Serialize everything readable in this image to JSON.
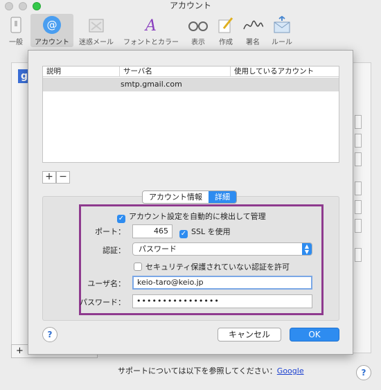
{
  "window": {
    "title": "アカウント"
  },
  "toolbar": {
    "items": [
      {
        "label": "一般",
        "icon": "general-icon"
      },
      {
        "label": "アカウント",
        "icon": "at-sign-icon"
      },
      {
        "label": "迷惑メール",
        "icon": "junk-icon"
      },
      {
        "label": "フォントとカラー",
        "icon": "font-color-icon"
      },
      {
        "label": "表示",
        "icon": "glasses-icon"
      },
      {
        "label": "作成",
        "icon": "compose-icon"
      },
      {
        "label": "署名",
        "icon": "signature-icon"
      },
      {
        "label": "ルール",
        "icon": "rules-icon"
      }
    ]
  },
  "table": {
    "headers": [
      "説明",
      "サーバ名",
      "使用しているアカウント"
    ],
    "rows": [
      {
        "description": "",
        "server": "smtp.gmail.com",
        "account": ""
      }
    ]
  },
  "buttons": {
    "add": "+",
    "remove": "−",
    "cancel": "キャンセル",
    "ok": "OK"
  },
  "tabs": {
    "info": "アカウント情報",
    "advanced": "詳細"
  },
  "form": {
    "auto_detect": "アカウント設定を自動的に検出して管理",
    "port_label": "ポート：",
    "port_value": "465",
    "ssl_label": "SSL を使用",
    "auth_label": "認証：",
    "auth_value": "パスワード",
    "insecure_label": "セキュリティ保護されていない認証を許可",
    "user_label": "ユーザ名：",
    "user_value": "keio-taro@keio.jp",
    "password_label": "パスワード：",
    "password_value": "••••••••••••••••"
  },
  "background": {
    "badge": "g",
    "support_text": "サポートについては以下を参照してください：",
    "support_link": "Google",
    "add": "+"
  },
  "help": "?",
  "colors": {
    "accent": "#2e8cf0",
    "highlight_border": "#8e3a8e"
  }
}
